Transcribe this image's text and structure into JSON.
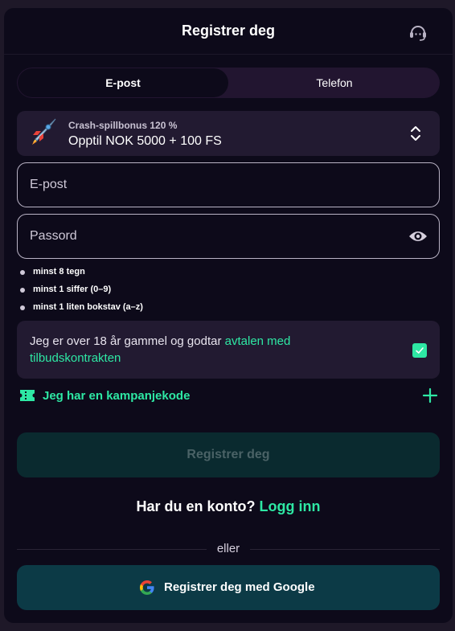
{
  "header": {
    "title": "Registrer deg",
    "support_icon": "headset-icon"
  },
  "tabs": [
    {
      "label": "E-post",
      "active": true
    },
    {
      "label": "Telefon",
      "active": false
    }
  ],
  "bonus": {
    "icon": "rocket-icon",
    "subtitle": "Crash-spillbonus 120 %",
    "title": "Opptil NOK 5000 + 100 FS"
  },
  "form": {
    "email_placeholder": "E-post",
    "email_value": "",
    "password_placeholder": "Passord",
    "password_value": ""
  },
  "password_rules": [
    "minst 8 tegn",
    "minst 1 siffer (0–9)",
    "minst 1 liten bokstav (a–z)"
  ],
  "terms": {
    "text": "Jeg er over 18 år gammel og godtar ",
    "link": "avtalen med tilbudskontrakten",
    "checked": true
  },
  "promo": {
    "label": "Jeg har en kampanjekode"
  },
  "register_button": "Registrer deg",
  "account": {
    "question": "Har du en konto? ",
    "login_link": "Logg inn"
  },
  "divider": "eller",
  "google_button": "Registrer deg med Google",
  "colors": {
    "accent": "#2ee8a4",
    "background": "#0d0a1a",
    "card": "#221a31",
    "register_button_bg": "#0a2a2f",
    "google_button_bg": "#0c3a46"
  }
}
